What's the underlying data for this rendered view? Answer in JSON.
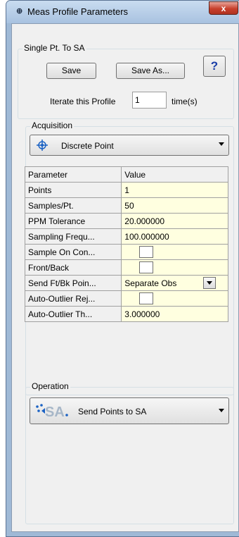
{
  "window": {
    "title": "Meas Profile Parameters",
    "close_glyph": "x",
    "icon": "profile-icon"
  },
  "single_pt_group": {
    "legend": "Single Pt. To SA",
    "save_label": "Save",
    "save_as_label": "Save As...",
    "help_label": "?",
    "iterate_label": "Iterate this Profile",
    "iterate_value": "1",
    "iterate_unit": "time(s)"
  },
  "acquisition": {
    "legend": "Acquisition",
    "mode": "Discrete Point",
    "mode_icon": "crosshair-target-icon"
  },
  "grid": {
    "headers": [
      "Parameter",
      "Value"
    ],
    "rows": [
      {
        "name": "Points",
        "value": "1",
        "kind": "text"
      },
      {
        "name": "Samples/Pt.",
        "value": "50",
        "kind": "text"
      },
      {
        "name": "PPM Tolerance",
        "value": "20.000000",
        "kind": "text"
      },
      {
        "name": "Sampling Frequ...",
        "value": "100.000000",
        "kind": "text"
      },
      {
        "name": "Sample On Con...",
        "value": "",
        "kind": "checkbox"
      },
      {
        "name": "Front/Back",
        "value": "",
        "kind": "checkbox"
      },
      {
        "name": "Send Ft/Bk Poin...",
        "value": "Separate Obs",
        "kind": "combo"
      },
      {
        "name": "Auto-Outlier Rej...",
        "value": "",
        "kind": "checkbox"
      },
      {
        "name": "Auto-Outlier Th...",
        "value": "3.000000",
        "kind": "text"
      }
    ]
  },
  "operation": {
    "legend": "Operation",
    "mode": "Send Points to SA",
    "mode_icon": "sa-logo-icon"
  },
  "colors": {
    "value_cell_bg": "#ffffe0",
    "client_bg": "#f0f0f0",
    "frame_blue": "#9fb9d6",
    "close_red": "#c8402c"
  }
}
